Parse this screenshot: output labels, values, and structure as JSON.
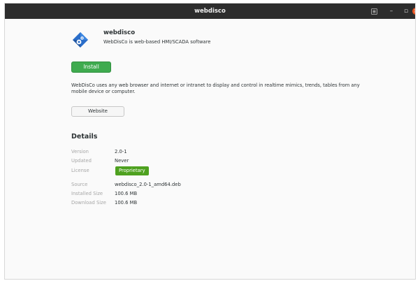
{
  "window": {
    "title": "webdisco",
    "controls": {
      "menu_icon": "hamburger-icon",
      "minimize_glyph": "–",
      "maximize_glyph": "▫",
      "close_glyph": "×"
    }
  },
  "app": {
    "icon": "webdisco-diamond-gear-icon",
    "name": "webdisco",
    "summary": "WebDisCo is web-based HMI/SCADA software",
    "install_label": "Install",
    "description": "WebDisCo uses any web browser and internet or intranet  to display and control in realtime mimics, trends,  tables from any mobile device or computer.",
    "website_label": "Website"
  },
  "details": {
    "heading": "Details",
    "version_label": "Version",
    "version": "2.0-1",
    "updated_label": "Updated",
    "updated": "Never",
    "license_label": "License",
    "license": "Proprietary",
    "source_label": "Source",
    "source": "webdisco_2.0-1_amd64.deb",
    "installed_size_label": "Installed Size",
    "installed_size": "100.6 MB",
    "download_size_label": "Download Size",
    "download_size": "100.6 MB"
  },
  "colors": {
    "titlebar": "#2d2d2d",
    "install_button": "#3fab4f",
    "license_badge": "#4ea11f",
    "close_button": "#e95420",
    "app_icon_blue": "#2a6dc9"
  }
}
